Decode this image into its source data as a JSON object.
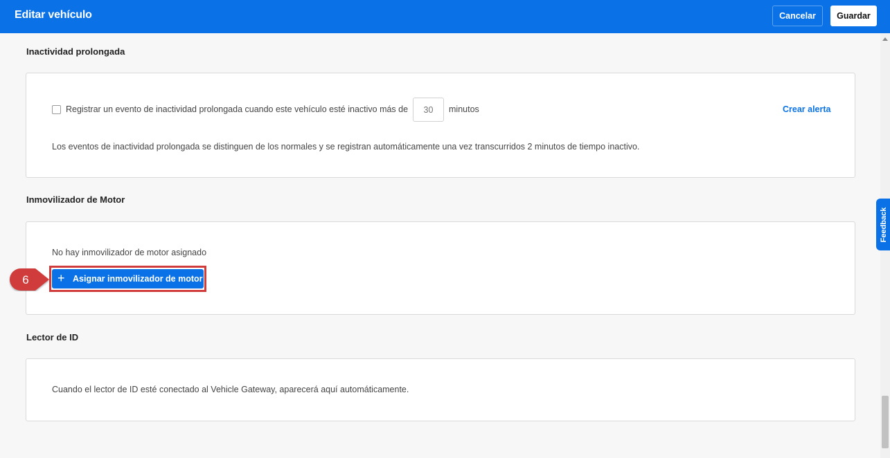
{
  "header": {
    "title": "Editar vehículo",
    "cancel_label": "Cancelar",
    "save_label": "Guardar"
  },
  "idle_section": {
    "title": "Inactividad prolongada",
    "checkbox_checked": false,
    "checkbox_label": "Registrar un evento de inactividad prolongada cuando este vehículo esté inactivo más de",
    "minutes_placeholder": "30",
    "minutes_unit": "minutos",
    "create_alert_label": "Crear alerta",
    "description": "Los eventos de inactividad prolongada se distinguen de los normales y se registran automáticamente una vez transcurridos 2 minutos de tiempo inactivo."
  },
  "immobilizer_section": {
    "title": "Inmovilizador de Motor",
    "empty_text": "No hay inmovilizador de motor asignado",
    "assign_label": "Asignar inmovilizador de motor"
  },
  "id_reader_section": {
    "title": "Lector de ID",
    "description": "Cuando el lector de ID esté conectado al Vehicle Gateway, aparecerá aquí automáticamente."
  },
  "callout": {
    "number": "6",
    "color": "#d03b3b"
  },
  "feedback": {
    "label": "Feedback"
  },
  "colors": {
    "accent": "#0a72e6",
    "highlight": "#d03b3b"
  },
  "icons": {
    "add": "plus-icon",
    "scroll": "scroll-up-arrow-icon"
  }
}
